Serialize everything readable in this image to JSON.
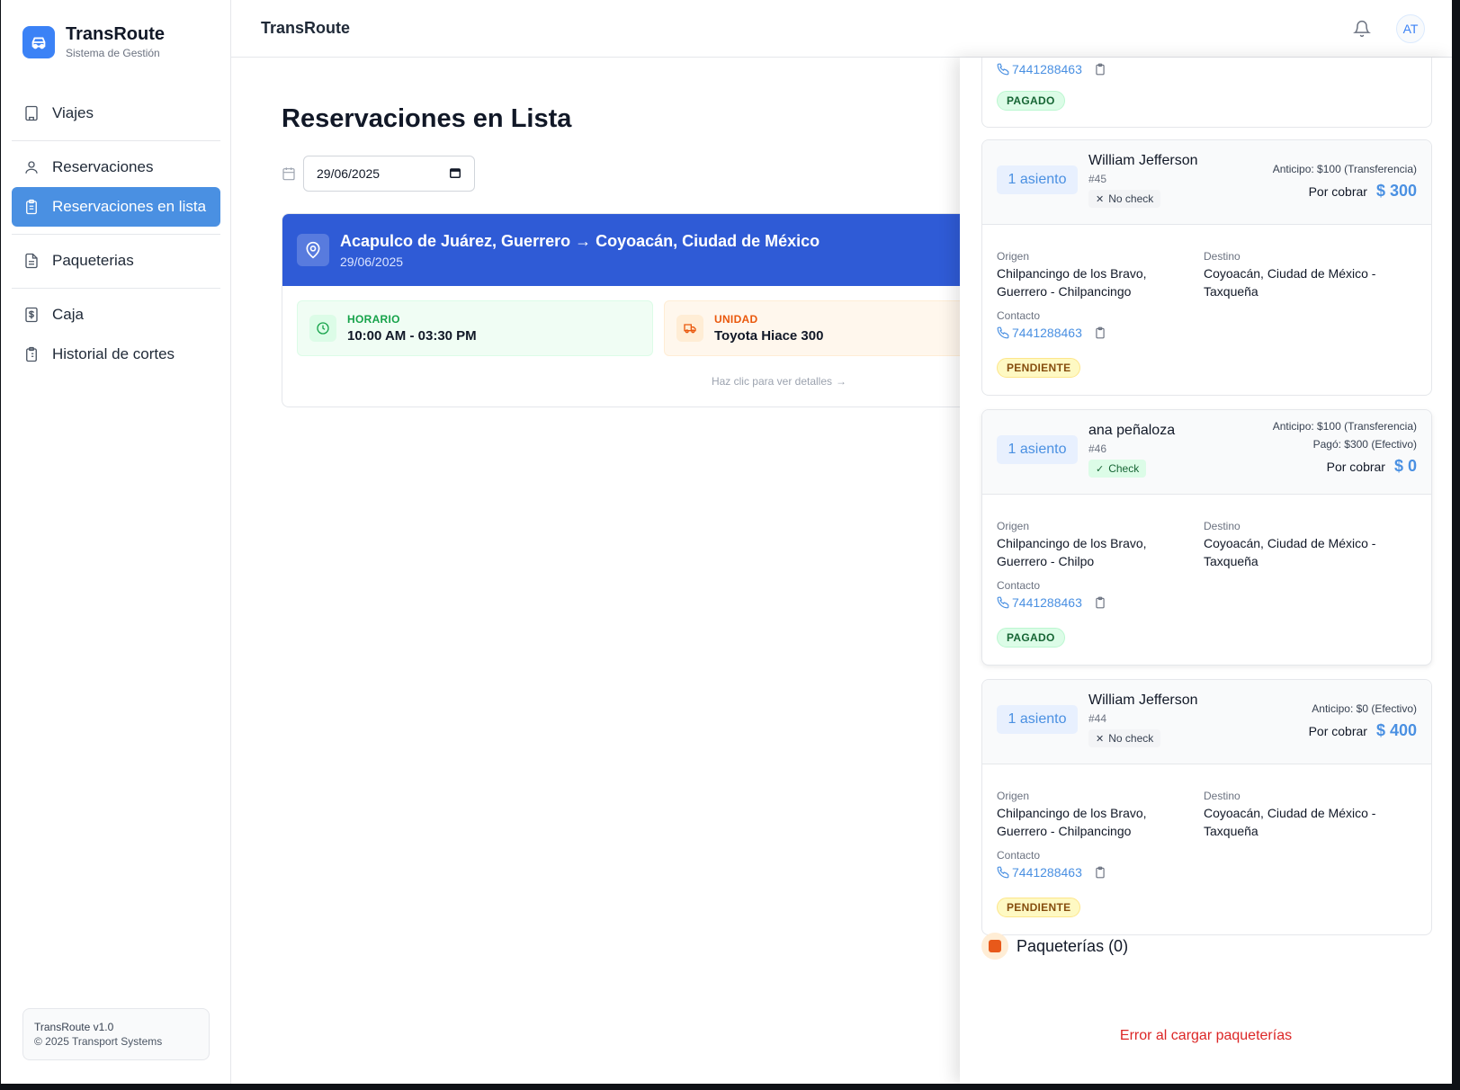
{
  "brand": {
    "name": "TransRoute",
    "subtitle": "Sistema de Gestión"
  },
  "nav": {
    "items": [
      {
        "label": "Viajes",
        "icon": "building-icon"
      },
      {
        "label": "Reservaciones",
        "icon": "user-icon"
      },
      {
        "label": "Reservaciones en lista",
        "icon": "clipboard-list-icon",
        "active": true
      },
      {
        "label": "Paqueterias",
        "icon": "file-icon"
      },
      {
        "label": "Caja",
        "icon": "dollar-file-icon"
      },
      {
        "label": "Historial de cortes",
        "icon": "clipboard-icon"
      }
    ]
  },
  "footer": {
    "version": "TransRoute v1.0",
    "copyright": "© 2025 Transport Systems"
  },
  "topbar": {
    "title": "TransRoute",
    "avatar": "AT"
  },
  "main": {
    "title": "Reservaciones en Lista",
    "date_value": "29/06/2025",
    "trip": {
      "route": "Acapulco de Juárez, Guerrero → Coyoacán, Ciudad de México",
      "date": "29/06/2025",
      "schedule_label": "HORARIO",
      "schedule_value": "10:00 AM - 03:30 PM",
      "unit_label": "UNIDAD",
      "unit_value": "Toyota Hiace 300",
      "details_link": "Haz clic para ver detalles"
    }
  },
  "drawer": {
    "partial_card": {
      "phone": "7441288463",
      "status": "PAGADO"
    },
    "reservations": [
      {
        "seats": "1 asiento",
        "name": "William Jefferson",
        "number": "#45",
        "check": "No check",
        "checked": false,
        "lines": [
          "Anticipo: $100 (Transferencia)"
        ],
        "cobrar_label": "Por cobrar",
        "cobrar_amount": "$ 300",
        "origen_label": "Origen",
        "origen": "Chilpancingo de los Bravo, Guerrero - Chilpancingo",
        "destino_label": "Destino",
        "destino": "Coyoacán, Ciudad de México - Taxqueña",
        "contacto_label": "Contacto",
        "phone": "7441288463",
        "status": "PENDIENTE"
      },
      {
        "seats": "1 asiento",
        "name": "ana peñaloza",
        "number": "#46",
        "check": "Check",
        "checked": true,
        "lines": [
          "Anticipo: $100 (Transferencia)",
          "Pagó: $300 (Efectivo)"
        ],
        "cobrar_label": "Por cobrar",
        "cobrar_amount": "$ 0",
        "origen_label": "Origen",
        "origen": "Chilpancingo de los Bravo, Guerrero - Chilpo",
        "destino_label": "Destino",
        "destino": "Coyoacán, Ciudad de México - Taxqueña",
        "contacto_label": "Contacto",
        "phone": "7441288463",
        "status": "PAGADO"
      },
      {
        "seats": "1 asiento",
        "name": "William Jefferson",
        "number": "#44",
        "check": "No check",
        "checked": false,
        "lines": [
          "Anticipo: $0 (Efectivo)"
        ],
        "cobrar_label": "Por cobrar",
        "cobrar_amount": "$ 400",
        "origen_label": "Origen",
        "origen": "Chilpancingo de los Bravo, Guerrero - Chilpancingo",
        "destino_label": "Destino",
        "destino": "Coyoacán, Ciudad de México - Taxqueña",
        "contacto_label": "Contacto",
        "phone": "7441288463",
        "status": "PENDIENTE"
      }
    ],
    "packages_title": "Paqueterías (0)",
    "packages_error": "Error al cargar paqueterías"
  },
  "colors": {
    "accent": "#4a90e2",
    "trip_header": "#2f5bd6",
    "error": "#dc2626"
  }
}
